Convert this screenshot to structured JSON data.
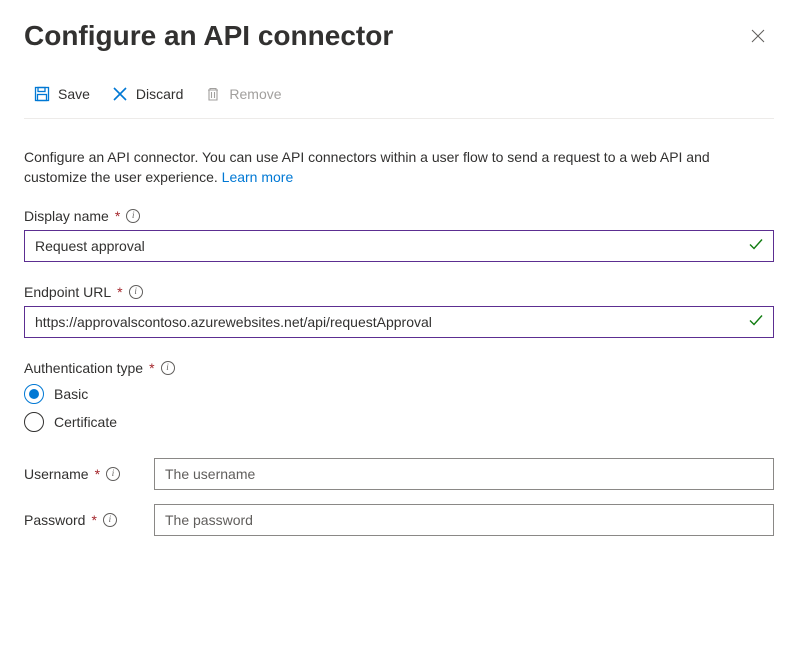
{
  "header": {
    "title": "Configure an API connector"
  },
  "toolbar": {
    "save_label": "Save",
    "discard_label": "Discard",
    "remove_label": "Remove"
  },
  "intro": {
    "text": "Configure an API connector. You can use API connectors within a user flow to send a request to a web API and customize the user experience. ",
    "learn_more": "Learn more"
  },
  "fields": {
    "display_name": {
      "label": "Display name",
      "value": "Request approval"
    },
    "endpoint_url": {
      "label": "Endpoint URL",
      "value": "https://approvalscontoso.azurewebsites.net/api/requestApproval"
    },
    "auth_type": {
      "label": "Authentication type",
      "options": {
        "basic": "Basic",
        "certificate": "Certificate"
      },
      "selected": "basic"
    },
    "username": {
      "label": "Username",
      "placeholder": "The username"
    },
    "password": {
      "label": "Password",
      "placeholder": "The password"
    }
  },
  "required_marker": "*"
}
